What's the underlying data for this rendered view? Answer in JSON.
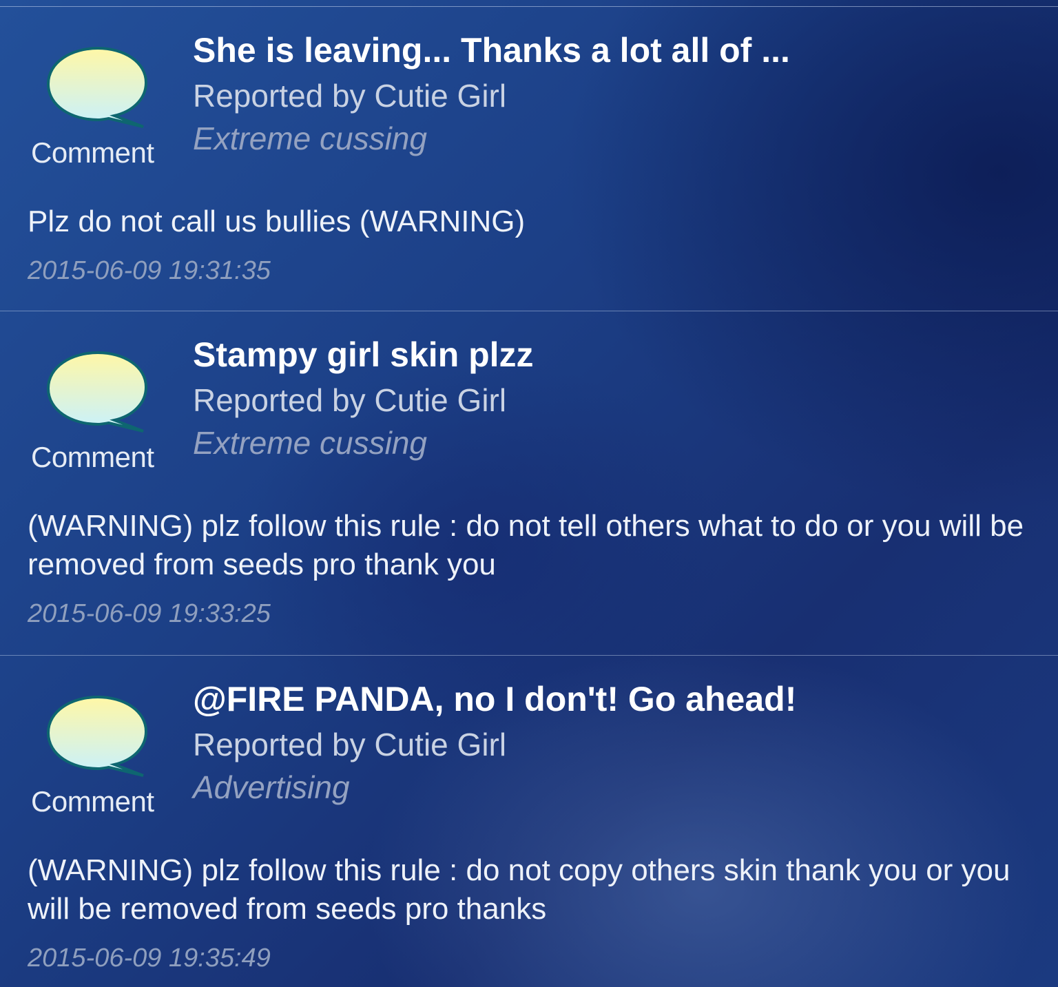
{
  "reports": [
    {
      "title": "She is leaving... Thanks a lot all of ...",
      "reporter": "Reported by Cutie Girl",
      "reason": "Extreme cussing",
      "message": "Plz do not call us bullies (WARNING)",
      "timestamp": "2015-06-09 19:31:35",
      "comment_label": "Comment",
      "icon": "speech-bubble-icon"
    },
    {
      "title": "Stampy girl skin plzz",
      "reporter": "Reported by Cutie Girl",
      "reason": "Extreme cussing",
      "message": "(WARNING) plz follow this rule : do not tell others what to do or you will be removed from seeds pro thank you",
      "timestamp": "2015-06-09 19:33:25",
      "comment_label": "Comment",
      "icon": "speech-bubble-icon"
    },
    {
      "title": "@FIRE PANDA, no I don't! Go ahead!",
      "reporter": "Reported by Cutie Girl",
      "reason": "Advertising",
      "message": "(WARNING) plz follow this rule : do not copy others skin thank you or you will be removed from seeds pro thanks",
      "timestamp": "2015-06-09 19:35:49",
      "comment_label": "Comment",
      "icon": "speech-bubble-icon"
    }
  ],
  "colors": {
    "bubble_top": "#fff7a6",
    "bubble_bottom": "#c7f1ff",
    "bubble_outline": "#0e6670"
  }
}
